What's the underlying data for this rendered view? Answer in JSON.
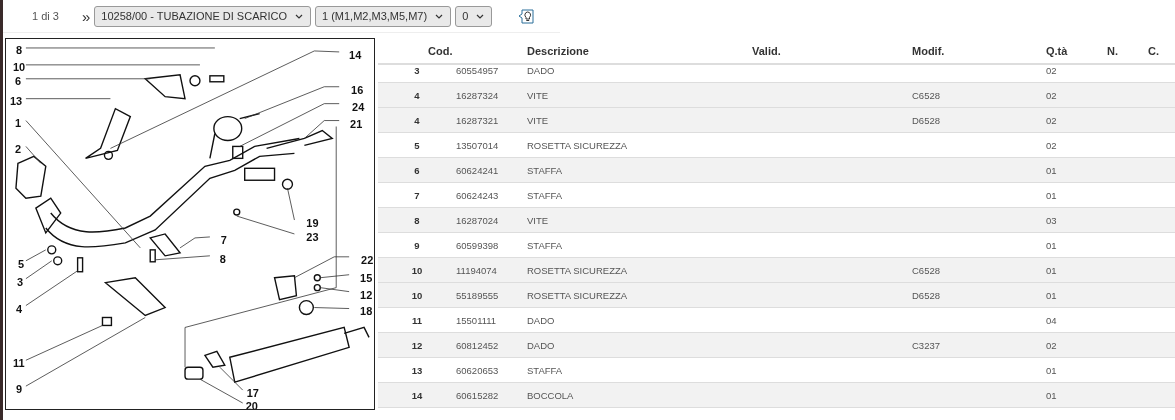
{
  "toolbar": {
    "page": "1 di 3",
    "next": "»",
    "selects": [
      {
        "value": "10258/00 - TUBAZIONE DI SCARICO"
      },
      {
        "value": "1 (M1,M2,M3,M5,M7)"
      },
      {
        "value": "0"
      }
    ]
  },
  "diagram": {
    "callouts": [
      {
        "label": "8"
      },
      {
        "label": "10"
      },
      {
        "label": "6"
      },
      {
        "label": "13"
      },
      {
        "label": "1"
      },
      {
        "label": "2"
      },
      {
        "label": "5"
      },
      {
        "label": "3"
      },
      {
        "label": "4"
      },
      {
        "label": "11"
      },
      {
        "label": "9"
      },
      {
        "label": "14"
      },
      {
        "label": "16"
      },
      {
        "label": "24"
      },
      {
        "label": "21"
      },
      {
        "label": "19"
      },
      {
        "label": "23"
      },
      {
        "label": "7"
      },
      {
        "label": "8"
      },
      {
        "label": "22"
      },
      {
        "label": "15"
      },
      {
        "label": "12"
      },
      {
        "label": "18"
      },
      {
        "label": "17"
      },
      {
        "label": "20"
      }
    ]
  },
  "table": {
    "columns": [
      "Cod.",
      "Descrizione",
      "Valid.",
      "Modif.",
      "Q.tà",
      "N.",
      "C."
    ],
    "rows": [
      {
        "ref": "3",
        "code": "60554957",
        "description": "DADO",
        "modif": "",
        "qty": "02"
      },
      {
        "ref": "4",
        "code": "16287324",
        "description": "VITE",
        "modif": "C6528",
        "qty": "02"
      },
      {
        "ref": "4",
        "code": "16287321",
        "description": "VITE",
        "modif": "D6528",
        "qty": "02"
      },
      {
        "ref": "5",
        "code": "13507014",
        "description": "ROSETTA SICUREZZA",
        "modif": "",
        "qty": "02"
      },
      {
        "ref": "6",
        "code": "60624241",
        "description": "STAFFA",
        "modif": "",
        "qty": "01"
      },
      {
        "ref": "7",
        "code": "60624243",
        "description": "STAFFA",
        "modif": "",
        "qty": "01"
      },
      {
        "ref": "8",
        "code": "16287024",
        "description": "VITE",
        "modif": "",
        "qty": "03"
      },
      {
        "ref": "9",
        "code": "60599398",
        "description": "STAFFA",
        "modif": "",
        "qty": "01"
      },
      {
        "ref": "10",
        "code": "11194074",
        "description": "ROSETTA SICUREZZA",
        "modif": "C6528",
        "qty": "01"
      },
      {
        "ref": "10",
        "code": "55189555",
        "description": "ROSETTA SICUREZZA",
        "modif": "D6528",
        "qty": "01"
      },
      {
        "ref": "11",
        "code": "15501111",
        "description": "DADO",
        "modif": "",
        "qty": "04"
      },
      {
        "ref": "12",
        "code": "60812452",
        "description": "DADO",
        "modif": "C3237",
        "qty": "02"
      },
      {
        "ref": "13",
        "code": "60620653",
        "description": "STAFFA",
        "modif": "",
        "qty": "01"
      },
      {
        "ref": "14",
        "code": "60615282",
        "description": "BOCCOLA",
        "modif": "",
        "qty": "01"
      }
    ]
  }
}
